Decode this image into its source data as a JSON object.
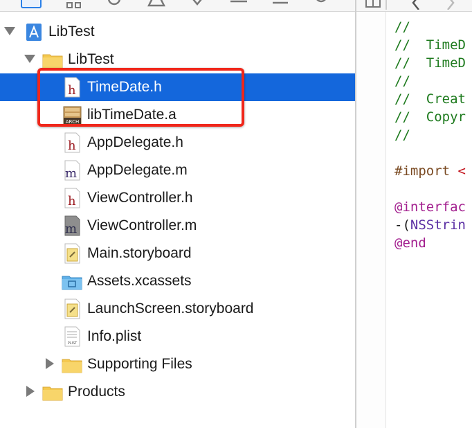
{
  "navigator": {
    "project": {
      "label": "LibTest"
    },
    "group": {
      "label": "LibTest"
    },
    "files": [
      {
        "label": "TimeDate.h",
        "icon": "header-file-icon",
        "selected": true
      },
      {
        "label": "libTimeDate.a",
        "icon": "static-library-icon"
      },
      {
        "label": "AppDelegate.h",
        "icon": "header-file-icon"
      },
      {
        "label": "AppDelegate.m",
        "icon": "objc-source-file-icon"
      },
      {
        "label": "ViewController.h",
        "icon": "header-file-icon"
      },
      {
        "label": "ViewController.m",
        "icon": "objc-source-file-modified-icon"
      },
      {
        "label": "Main.storyboard",
        "icon": "storyboard-icon"
      },
      {
        "label": "Assets.xcassets",
        "icon": "asset-catalog-icon"
      },
      {
        "label": "LaunchScreen.storyboard",
        "icon": "storyboard-icon"
      },
      {
        "label": "Info.plist",
        "icon": "plist-icon"
      }
    ],
    "supporting": {
      "label": "Supporting Files"
    },
    "products": {
      "label": "Products"
    },
    "library_icon_text": "ARCH",
    "plist_icon_text": "PLIST"
  },
  "editor": {
    "lines": [
      {
        "cls": "c-comment",
        "text": "//"
      },
      {
        "cls": "c-comment",
        "text": "//  TimeD"
      },
      {
        "cls": "c-comment",
        "text": "//  TimeD"
      },
      {
        "cls": "c-comment",
        "text": "//"
      },
      {
        "cls": "c-comment",
        "text": "//  Creat"
      },
      {
        "cls": "c-comment",
        "text": "//  Copyr"
      },
      {
        "cls": "c-comment",
        "text": "//"
      }
    ],
    "import_keyword": "#import",
    "import_rest": " <",
    "interface_keyword": "@interfac",
    "method_prefix": "-(",
    "method_type": "NSStrin",
    "end_keyword": "@end"
  },
  "colors": {
    "selection": "#1467dc",
    "highlight": "#f0271b",
    "folder": "#f5c94f"
  }
}
